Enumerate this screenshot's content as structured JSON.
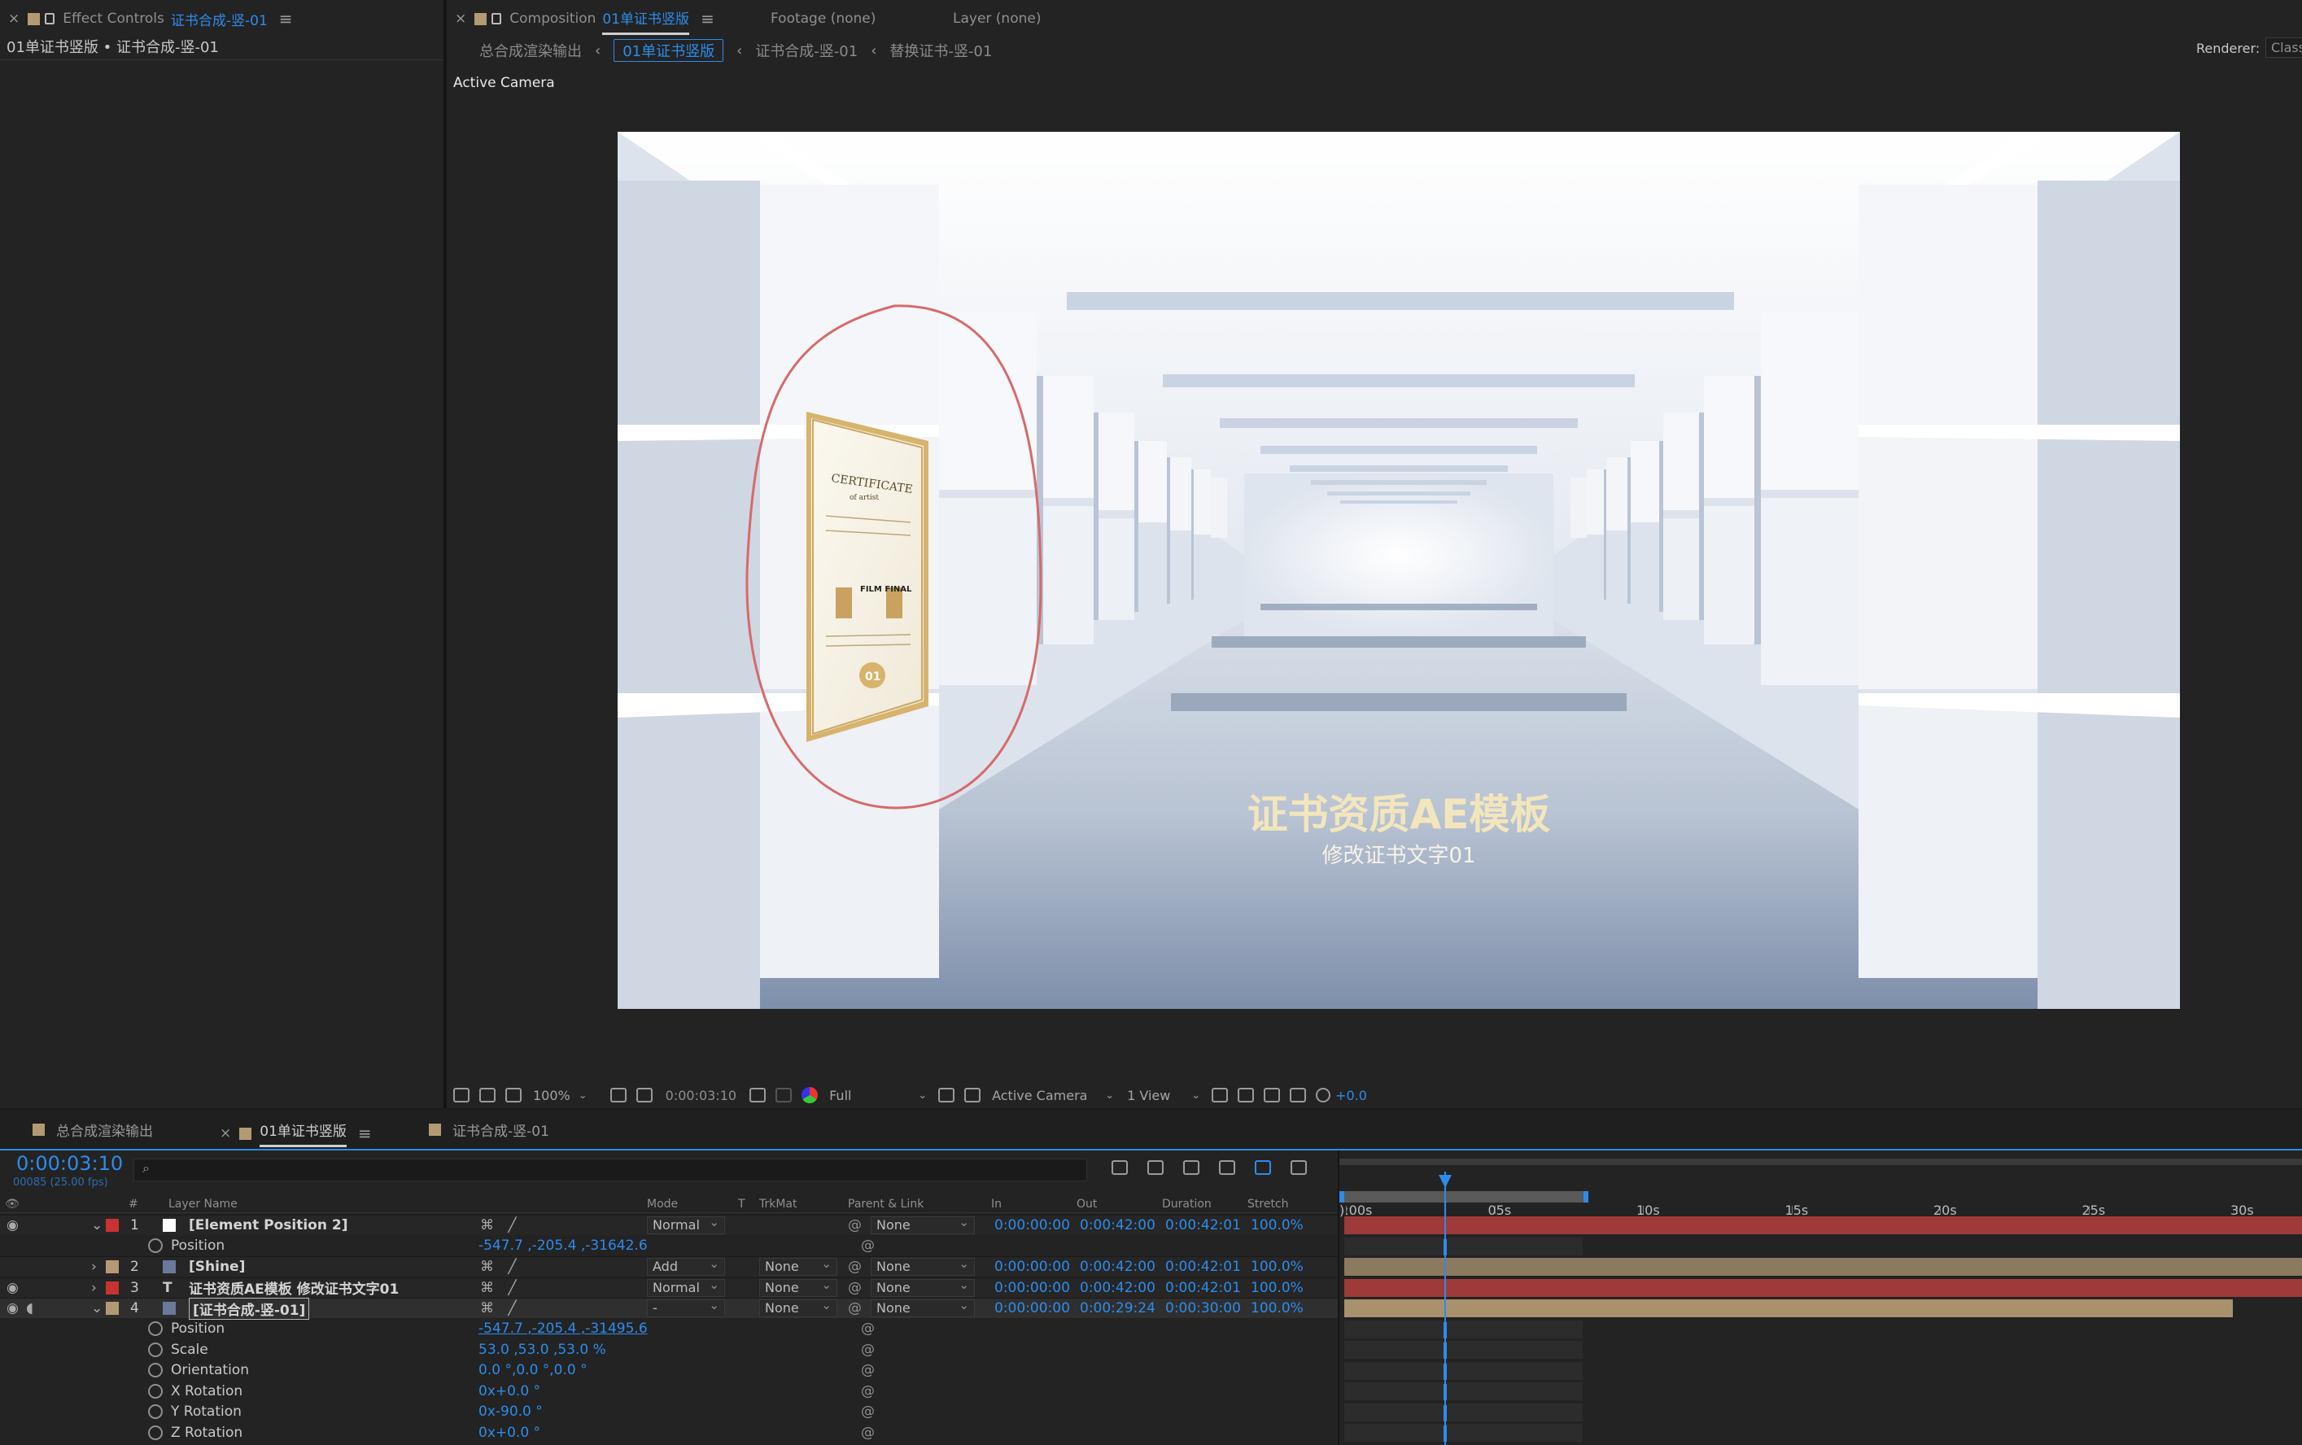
{
  "effect_panel": {
    "tab_prefix": "Effect Controls",
    "tab_name": "证书合成-竖-01",
    "subtitle": "01单证书竖版 • 证书合成-竖-01"
  },
  "comp_panel": {
    "tab_prefix": "Composition",
    "tab_name": "01单证书竖版",
    "footage_tab": "Footage  (none)",
    "layer_tab": "Layer  (none)",
    "breadcrumbs": [
      "总合成渲染输出",
      "01单证书竖版",
      "证书合成-竖-01",
      "替换证书-竖-01"
    ],
    "renderer_label": "Renderer:",
    "renderer_value": "Class",
    "view_label": "Active Camera"
  },
  "scene": {
    "title_text": "证书资质AE模板",
    "subtitle_text": "修改证书文字01",
    "cert_title": "CERTIFICATE",
    "cert_sub": "of artist",
    "cert_mid": "FILM FINAL",
    "cert_num": "01"
  },
  "viewer_toolbar": {
    "zoom": "100%",
    "time": "0:00:03:10",
    "resolution": "Full",
    "camera": "Active Camera",
    "views": "1 View",
    "exposure": "+0.0"
  },
  "timeline": {
    "tabs": [
      "总合成渲染输出",
      "01单证书竖版",
      "证书合成-竖-01"
    ],
    "active_tab": 1,
    "current_time": "0:00:03:10",
    "frame_info": "00085 (25.00 fps)",
    "search_placeholder": "",
    "columns": {
      "hash": "#",
      "layer_name": "Layer Name",
      "mode": "Mode",
      "t": "T",
      "trkmat": "TrkMat",
      "parent": "Parent & Link",
      "in": "In",
      "out": "Out",
      "duration": "Duration",
      "stretch": "Stretch"
    },
    "ruler": [
      "):00s",
      "05s",
      "10s",
      "15s",
      "20s",
      "25s",
      "30s"
    ],
    "layers": [
      {
        "num": "1",
        "name": "[Element Position 2]",
        "label_color": "#c83232",
        "mode": "Normal",
        "trkmat": "",
        "parent": "None",
        "in": "0:00:00:00",
        "out": "0:00:42:00",
        "duration": "0:00:42:01",
        "stretch": "100.0%",
        "bar_color": "#9e3a3a"
      },
      {
        "num": "2",
        "name": "[Shine]",
        "label_color": "#b49a72",
        "mode": "Add",
        "trkmat": "None",
        "parent": "None",
        "in": "0:00:00:00",
        "out": "0:00:42:00",
        "duration": "0:00:42:01",
        "stretch": "100.0%",
        "bar_color": "#8c7a60"
      },
      {
        "num": "3",
        "name": "证书资质AE模板 修改证书文字01",
        "label_color": "#c83232",
        "mode": "Normal",
        "trkmat": "None",
        "parent": "None",
        "in": "0:00:00:00",
        "out": "0:00:42:00",
        "duration": "0:00:42:01",
        "stretch": "100.0%",
        "bar_color": "#9e3a3a"
      },
      {
        "num": "4",
        "name": "[证书合成-竖-01]",
        "label_color": "#b49a72",
        "mode": "-",
        "trkmat": "None",
        "parent": "None",
        "in": "0:00:00:00",
        "out": "0:00:29:24",
        "duration": "0:00:30:00",
        "stretch": "100.0%",
        "bar_color": "#a8916c"
      }
    ],
    "layer1_prop": {
      "name": "Position",
      "value": "-547.7 ,-205.4 ,-31642.6"
    },
    "layer4_props": [
      {
        "name": "Position",
        "value": "-547.7 ,-205.4 ,-31495.6"
      },
      {
        "name": "Scale",
        "value": "53.0 ,53.0 ,53.0 %"
      },
      {
        "name": "Orientation",
        "value": "0.0 °,0.0 °,0.0 °"
      },
      {
        "name": "X Rotation",
        "value": "0x+0.0 °"
      },
      {
        "name": "Y Rotation",
        "value": "0x-90.0 °"
      },
      {
        "name": "Z Rotation",
        "value": "0x+0.0 °"
      }
    ]
  },
  "colors": {
    "accent": "#2d8ceb",
    "red_annotation": "#d9534f"
  }
}
